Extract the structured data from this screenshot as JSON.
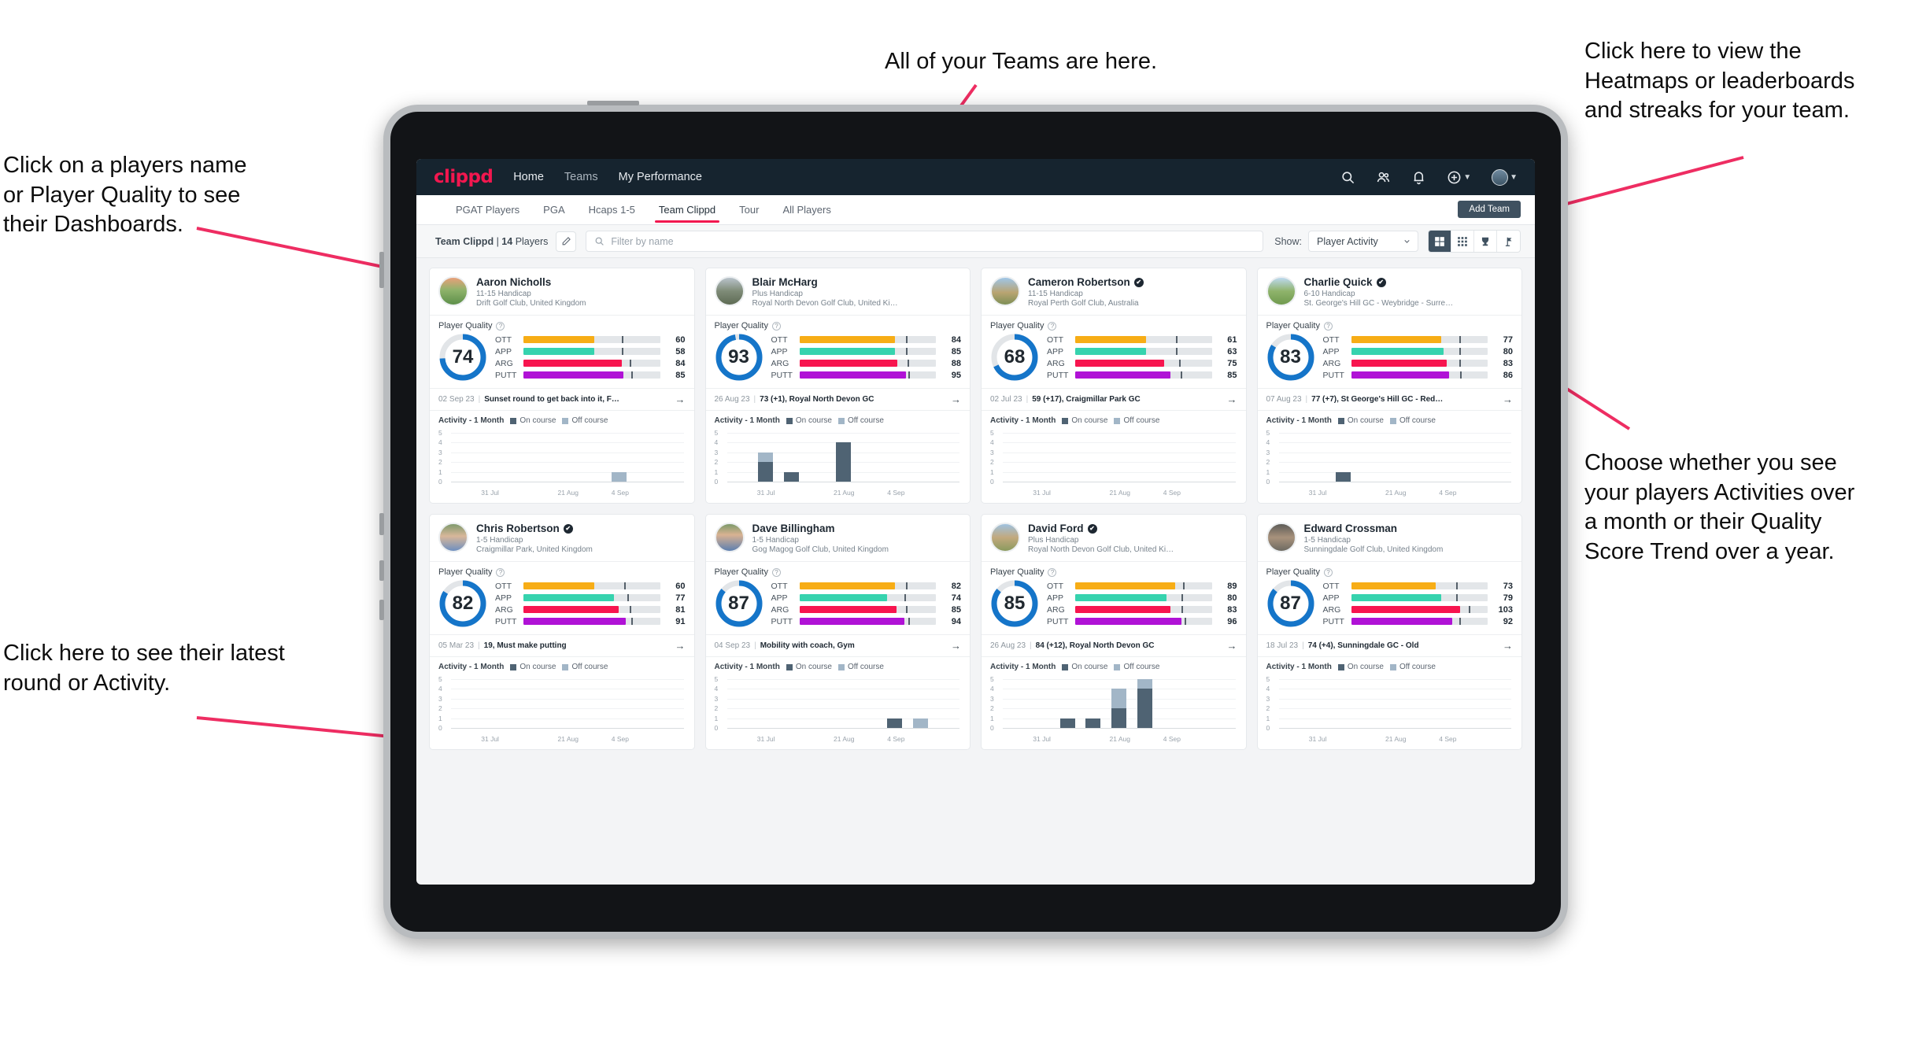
{
  "annotations": [
    {
      "id": "teams-note",
      "text": "All of your Teams are here."
    },
    {
      "id": "heatmaps-note",
      "text": "Click here to view the\nHeatmaps or leaderboards\nand streaks for your team."
    },
    {
      "id": "players-note",
      "text": "Click on a players name\nor Player Quality to see\ntheir Dashboards."
    },
    {
      "id": "show-note",
      "text": "Choose whether you see\nyour players Activities over\na month or their Quality\nScore Trend over a year."
    },
    {
      "id": "latest-note",
      "text": "Click here to see their latest\nround or Activity."
    }
  ],
  "app": {
    "brand": "clippd",
    "nav_links": [
      {
        "label": "Home",
        "active": true
      },
      {
        "label": "Teams",
        "active": false
      },
      {
        "label": "My Performance",
        "active": true
      }
    ],
    "nav_icons": [
      "search-icon",
      "people-icon",
      "bell-icon",
      "plus-circle-icon",
      "avatar"
    ],
    "subtabs": [
      {
        "label": "PGAT Players",
        "active": false
      },
      {
        "label": "PGA",
        "active": false
      },
      {
        "label": "Hcaps 1-5",
        "active": false
      },
      {
        "label": "Team Clippd",
        "active": true
      },
      {
        "label": "Tour",
        "active": false
      },
      {
        "label": "All Players",
        "active": false
      }
    ],
    "add_team_label": "Add Team",
    "toolbar": {
      "team_name": "Team Clippd",
      "player_count": "14",
      "players_word": "Players",
      "separator": "|",
      "edit_icon": "pencil-icon",
      "search_placeholder": "Filter by name",
      "search_value": "",
      "show_label": "Show:",
      "show_value": "Player Activity",
      "view_buttons": [
        "grid-large-icon",
        "grid-small-icon",
        "trophy-icon",
        "flag-icon"
      ],
      "active_view": 0
    },
    "accent": "#f2174f",
    "navbar_bg": "#16242f"
  },
  "labels": {
    "player_quality": "Player Quality",
    "activity_title": "Activity - 1 Month",
    "legend_on": "On course",
    "legend_off": "Off course",
    "metric_names": [
      "OTT",
      "APP",
      "ARG",
      "PUTT"
    ],
    "arrow": "→"
  },
  "colors": {
    "ott": "#f7ad16",
    "app": "#36d3ae",
    "arg": "#f7154f",
    "putt": "#b012d6",
    "ring": "#1575c9",
    "on_course": "#4f6373",
    "off_course": "#a2b6c7"
  },
  "chart_data": {
    "type": "bar",
    "title": "Activity - 1 Month",
    "ylim": [
      0,
      5
    ],
    "yticks": [
      0,
      1,
      2,
      3,
      4,
      5
    ],
    "xticks": [
      "31 Jul",
      "21 Aug",
      "4 Sep"
    ],
    "legend": [
      "On course",
      "Off course"
    ],
    "legend_position": "top-right",
    "grid": true,
    "panels": [
      {
        "player": "Aaron Nicholls",
        "bins": 9,
        "on_course": [
          0,
          0,
          0,
          0,
          0,
          0,
          0,
          0,
          0
        ],
        "off_course": [
          0,
          0,
          0,
          0,
          0,
          0,
          1,
          0,
          0
        ]
      },
      {
        "player": "Blair McHarg",
        "bins": 9,
        "on_course": [
          0,
          2,
          1,
          0,
          4,
          0,
          0,
          0,
          0
        ],
        "off_course": [
          0,
          1,
          0,
          0,
          0,
          0,
          0,
          0,
          0
        ]
      },
      {
        "player": "Cameron Robertson",
        "bins": 9,
        "on_course": [
          0,
          0,
          0,
          0,
          0,
          0,
          0,
          0,
          0
        ],
        "off_course": [
          0,
          0,
          0,
          0,
          0,
          0,
          0,
          0,
          0
        ]
      },
      {
        "player": "Charlie Quick",
        "bins": 9,
        "on_course": [
          0,
          0,
          1,
          0,
          0,
          0,
          0,
          0,
          0
        ],
        "off_course": [
          0,
          0,
          0,
          0,
          0,
          0,
          0,
          0,
          0
        ]
      },
      {
        "player": "Chris Robertson",
        "bins": 9,
        "on_course": [
          0,
          0,
          0,
          0,
          0,
          0,
          0,
          0,
          0
        ],
        "off_course": [
          0,
          0,
          0,
          0,
          0,
          0,
          0,
          0,
          0
        ]
      },
      {
        "player": "Dave Billingham",
        "bins": 9,
        "on_course": [
          0,
          0,
          0,
          0,
          0,
          0,
          1,
          0,
          0
        ],
        "off_course": [
          0,
          0,
          0,
          0,
          0,
          0,
          0,
          1,
          0
        ]
      },
      {
        "player": "David Ford",
        "bins": 9,
        "on_course": [
          0,
          0,
          1,
          1,
          2,
          4,
          0,
          0,
          0
        ],
        "off_course": [
          0,
          0,
          0,
          0,
          2,
          1,
          0,
          0,
          0
        ]
      },
      {
        "player": "Edward Crossman",
        "bins": 9,
        "on_course": [
          0,
          0,
          0,
          0,
          0,
          0,
          0,
          0,
          0
        ],
        "off_course": [
          0,
          0,
          0,
          0,
          0,
          0,
          0,
          0,
          0
        ]
      }
    ]
  },
  "players": [
    {
      "name": "Aaron Nicholls",
      "verified": false,
      "handicap": "11-15 Handicap",
      "club": "Drift Golf Club, United Kingdom",
      "quality": "74",
      "ring_pct": 74,
      "metrics": [
        {
          "name": "OTT",
          "value": "60",
          "fill": 52,
          "tick": 72
        },
        {
          "name": "APP",
          "value": "58",
          "fill": 52,
          "tick": 72
        },
        {
          "name": "ARG",
          "value": "84",
          "fill": 72,
          "tick": 78
        },
        {
          "name": "PUTT",
          "value": "85",
          "fill": 73,
          "tick": 79
        }
      ],
      "latest_date": "02 Sep 23",
      "latest_text": "Sunset round to get back into it, F…"
    },
    {
      "name": "Blair McHarg",
      "verified": false,
      "handicap": "Plus Handicap",
      "club": "Royal North Devon Golf Club, United Kin…",
      "quality": "93",
      "ring_pct": 97,
      "metrics": [
        {
          "name": "OTT",
          "value": "84",
          "fill": 70,
          "tick": 78
        },
        {
          "name": "APP",
          "value": "85",
          "fill": 70,
          "tick": 78
        },
        {
          "name": "ARG",
          "value": "88",
          "fill": 72,
          "tick": 79
        },
        {
          "name": "PUTT",
          "value": "95",
          "fill": 78,
          "tick": 80
        }
      ],
      "latest_date": "26 Aug 23",
      "latest_text": "73 (+1), Royal North Devon GC"
    },
    {
      "name": "Cameron Robertson",
      "verified": true,
      "handicap": "11-15 Handicap",
      "club": "Royal Perth Golf Club, Australia",
      "quality": "68",
      "ring_pct": 68,
      "metrics": [
        {
          "name": "OTT",
          "value": "61",
          "fill": 52,
          "tick": 74
        },
        {
          "name": "APP",
          "value": "63",
          "fill": 52,
          "tick": 74
        },
        {
          "name": "ARG",
          "value": "75",
          "fill": 65,
          "tick": 76
        },
        {
          "name": "PUTT",
          "value": "85",
          "fill": 70,
          "tick": 77
        }
      ],
      "latest_date": "02 Jul 23",
      "latest_text": "59 (+17), Craigmillar Park GC"
    },
    {
      "name": "Charlie Quick",
      "verified": true,
      "handicap": "6-10 Handicap",
      "club": "St. George's Hill GC - Weybridge - Surrey, …",
      "quality": "83",
      "ring_pct": 84,
      "metrics": [
        {
          "name": "OTT",
          "value": "77",
          "fill": 66,
          "tick": 79
        },
        {
          "name": "APP",
          "value": "80",
          "fill": 68,
          "tick": 79
        },
        {
          "name": "ARG",
          "value": "83",
          "fill": 70,
          "tick": 79
        },
        {
          "name": "PUTT",
          "value": "86",
          "fill": 72,
          "tick": 80
        }
      ],
      "latest_date": "07 Aug 23",
      "latest_text": "77 (+7), St George's Hill GC - Red…"
    },
    {
      "name": "Chris Robertson",
      "verified": true,
      "handicap": "1-5 Handicap",
      "club": "Craigmillar Park, United Kingdom",
      "quality": "82",
      "ring_pct": 84,
      "metrics": [
        {
          "name": "OTT",
          "value": "60",
          "fill": 52,
          "tick": 74
        },
        {
          "name": "APP",
          "value": "77",
          "fill": 66,
          "tick": 76
        },
        {
          "name": "ARG",
          "value": "81",
          "fill": 70,
          "tick": 78
        },
        {
          "name": "PUTT",
          "value": "91",
          "fill": 75,
          "tick": 79
        }
      ],
      "latest_date": "05 Mar 23",
      "latest_text": "19, Must make putting"
    },
    {
      "name": "Dave Billingham",
      "verified": false,
      "handicap": "1-5 Handicap",
      "club": "Gog Magog Golf Club, United Kingdom",
      "quality": "87",
      "ring_pct": 86,
      "metrics": [
        {
          "name": "OTT",
          "value": "82",
          "fill": 70,
          "tick": 78
        },
        {
          "name": "APP",
          "value": "74",
          "fill": 64,
          "tick": 77
        },
        {
          "name": "ARG",
          "value": "85",
          "fill": 71,
          "tick": 78
        },
        {
          "name": "PUTT",
          "value": "94",
          "fill": 77,
          "tick": 80
        }
      ],
      "latest_date": "04 Sep 23",
      "latest_text": "Mobility with coach, Gym"
    },
    {
      "name": "David Ford",
      "verified": true,
      "handicap": "Plus Handicap",
      "club": "Royal North Devon Golf Club, United Kin…",
      "quality": "85",
      "ring_pct": 86,
      "metrics": [
        {
          "name": "OTT",
          "value": "89",
          "fill": 73,
          "tick": 79
        },
        {
          "name": "APP",
          "value": "80",
          "fill": 67,
          "tick": 78
        },
        {
          "name": "ARG",
          "value": "83",
          "fill": 70,
          "tick": 78
        },
        {
          "name": "PUTT",
          "value": "96",
          "fill": 78,
          "tick": 80
        }
      ],
      "latest_date": "26 Aug 23",
      "latest_text": "84 (+12), Royal North Devon GC"
    },
    {
      "name": "Edward Crossman",
      "verified": false,
      "handicap": "1-5 Handicap",
      "club": "Sunningdale Golf Club, United Kingdom",
      "quality": "87",
      "ring_pct": 86,
      "metrics": [
        {
          "name": "OTT",
          "value": "73",
          "fill": 62,
          "tick": 77
        },
        {
          "name": "APP",
          "value": "79",
          "fill": 66,
          "tick": 77
        },
        {
          "name": "ARG",
          "value": "103",
          "fill": 80,
          "tick": 86
        },
        {
          "name": "PUTT",
          "value": "92",
          "fill": 74,
          "tick": 79
        }
      ],
      "latest_date": "18 Jul 23",
      "latest_text": "74 (+4), Sunningdale GC - Old"
    }
  ]
}
